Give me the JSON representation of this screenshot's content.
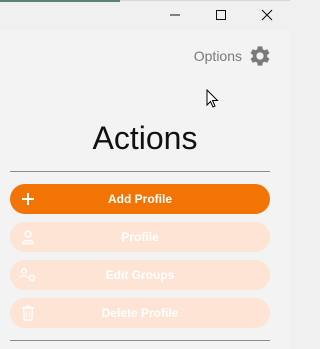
{
  "window": {
    "minimize_icon": "minimize-icon",
    "maximize_icon": "maximize-icon",
    "close_icon": "close-icon"
  },
  "options": {
    "label": "Options",
    "icon": "gear-icon"
  },
  "heading": "Actions",
  "actions": [
    {
      "label": "Add Profile",
      "icon": "plus-icon",
      "state": "enabled"
    },
    {
      "label": "Profile",
      "icon": "user-icon",
      "state": "disabled"
    },
    {
      "label": "Edit Groups",
      "icon": "group-settings-icon",
      "state": "disabled"
    },
    {
      "label": "Delete Profile",
      "icon": "trash-icon",
      "state": "disabled"
    }
  ],
  "colors": {
    "accent": "#f27405",
    "disabled": "#fde4d4",
    "background": "#f3f3f3"
  }
}
